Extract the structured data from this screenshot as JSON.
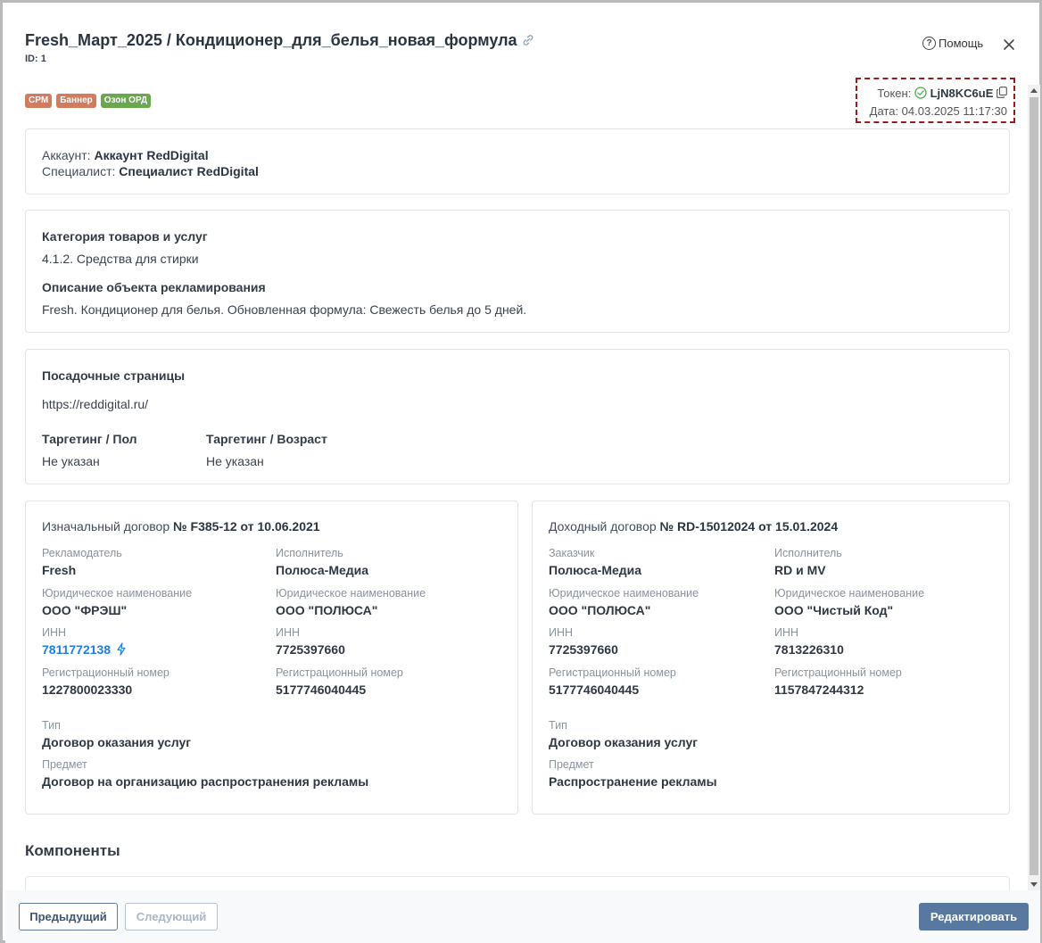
{
  "header": {
    "title": "Fresh_Март_2025 / Кондиционер_для_белья_новая_формула",
    "id_label": "ID: 1",
    "help_label": "Помощь"
  },
  "badges": [
    {
      "label": "CPM",
      "color": "#d17b5f"
    },
    {
      "label": "Баннер",
      "color": "#d17b5f"
    },
    {
      "label": "Озон ОРД",
      "color": "#6aa84f"
    }
  ],
  "token": {
    "label": "Токен:",
    "value": "LjN8KC6uE",
    "date_label": "Дата:",
    "date_value": "04.03.2025 11:17:30"
  },
  "account": {
    "account_label": "Аккаунт:",
    "account_value": "Аккаунт RedDigital",
    "specialist_label": "Специалист:",
    "specialist_value": "Специалист RedDigital"
  },
  "category": {
    "title": "Категория товаров и услуг",
    "value": "4.1.2. Средства для стирки",
    "desc_title": "Описание объекта рекламирования",
    "desc_value": "Fresh. Кондиционер для белья. Обновленная формула: Свежесть белья до 5 дней."
  },
  "landing": {
    "title": "Посадочные страницы",
    "url": "https://reddigital.ru/",
    "gender_title": "Таргетинг / Пол",
    "gender_value": "Не указан",
    "age_title": "Таргетинг / Возраст",
    "age_value": "Не указан"
  },
  "initial_contract": {
    "title_prefix": "Изначальный договор",
    "title_number": "№ F385-12 от 10.06.2021",
    "left": [
      {
        "label": "Рекламодатель",
        "value": "Fresh"
      },
      {
        "label": "Юридическое наименование",
        "value": "ООО \"ФРЭШ\""
      },
      {
        "label": "ИНН",
        "value": "7811772138"
      },
      {
        "label": "Регистрационный номер",
        "value": "1227800023330"
      }
    ],
    "right": [
      {
        "label": "Исполнитель",
        "value": "Полюса-Медиа"
      },
      {
        "label": "Юридическое наименование",
        "value": "ООО \"ПОЛЮСА\""
      },
      {
        "label": "ИНН",
        "value": "7725397660"
      },
      {
        "label": "Регистрационный номер",
        "value": "5177746040445"
      }
    ],
    "type_label": "Тип",
    "type_value": "Договор оказания услуг",
    "subject_label": "Предмет",
    "subject_value": "Договор на организацию распространения рекламы"
  },
  "income_contract": {
    "title_prefix": "Доходный договор",
    "title_number": "№ RD-15012024 от 15.01.2024",
    "left": [
      {
        "label": "Заказчик",
        "value": "Полюса-Медиа"
      },
      {
        "label": "Юридическое наименование",
        "value": "ООО \"ПОЛЮСА\""
      },
      {
        "label": "ИНН",
        "value": "7725397660"
      },
      {
        "label": "Регистрационный номер",
        "value": "5177746040445"
      }
    ],
    "right": [
      {
        "label": "Исполнитель",
        "value": "RD и MV"
      },
      {
        "label": "Юридическое наименование",
        "value": "ООО \"Чистый Код\""
      },
      {
        "label": "ИНН",
        "value": "7813226310"
      },
      {
        "label": "Регистрационный номер",
        "value": "1157847244312"
      }
    ],
    "type_label": "Тип",
    "type_value": "Договор оказания услуг",
    "subject_label": "Предмет",
    "subject_value": "Распространение рекламы"
  },
  "components": {
    "title": "Компоненты"
  },
  "footer": {
    "prev_label": "Предыдущий",
    "next_label": "Следующий",
    "edit_label": "Редактировать"
  }
}
